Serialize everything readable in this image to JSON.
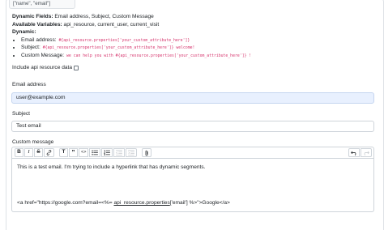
{
  "code_box": {
    "text": "[\"name\", \"email\"]"
  },
  "info": {
    "dynamic_fields_label": "Dynamic Fields:",
    "dynamic_fields_value": " Email address, Subject, Custom Message",
    "available_variables_label": "Available Variables:",
    "available_variables_value": " api_resource, current_user, current_visit",
    "dynamic_label": "Dynamic:",
    "items": [
      {
        "label": "Email address:",
        "code": " #{api_resource.properties['your_custom_attribute_here']}"
      },
      {
        "label": "Subject:",
        "code": " #{api_resource.properties['your_custom_attribute_here']} welcome!"
      },
      {
        "label": "Custom Message:",
        "code": " we can help you with #{api_resource.properties['your_custom_attribute_here']} !"
      }
    ]
  },
  "checkbox": {
    "label": "Include api resource data"
  },
  "email_field": {
    "label": "Email address",
    "value": "user@example.com"
  },
  "subject_field": {
    "label": "Subject",
    "value": "Test email"
  },
  "message_field": {
    "label": "Custom message",
    "body_text": "This is a test email. I'm trying to include a hyperlink that has dynamic segments.",
    "link_prefix": "<a href=\"https://google.com?email=<%= ",
    "link_underlined": "api_resource.properties",
    "link_suffix": "['email'] %>\">Google</a>"
  },
  "toolbar": {
    "bold": "B",
    "italic": "I",
    "strike": "S",
    "heading": "T",
    "quote": "”",
    "code": "<>"
  }
}
